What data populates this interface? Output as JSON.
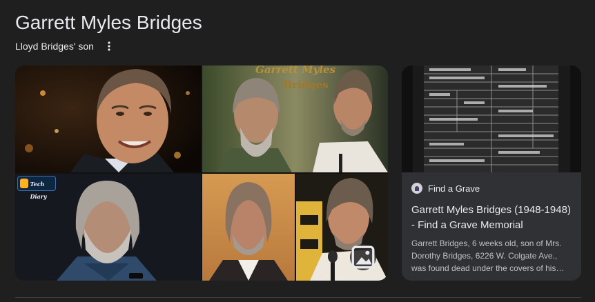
{
  "entity": {
    "title": "Garrett Myles Bridges",
    "subtitle": "Lloyd Bridges' son"
  },
  "images": {
    "tiles": [
      {
        "alt": "Man smiling at night event"
      },
      {
        "alt": "Garrett Myles Bridges side by side",
        "watermark_line1": "Garrett Myles",
        "watermark_line2": "Bridges"
      },
      {
        "alt": "Man with long grey hair and beard",
        "badge_line1": "The Tech",
        "badge_line2": "Diary"
      },
      {
        "alt": "Portrait on orange background"
      },
      {
        "alt": "Man speaking at a microphone"
      }
    ],
    "button_icon": "image-icon"
  },
  "source_card": {
    "source_name": "Find a Grave",
    "title": "Garrett Myles Bridges (1948-1948) - Find a Grave Memorial",
    "snippet": "Garrett Bridges, 6 weeks old, son of Mrs. Dorothy Bridges, 6226 W. Colgate Ave., was found dead under the covers of his…",
    "favicon_icon": "find-a-grave-icon"
  },
  "colors": {
    "background": "#1f1f1f",
    "card_background": "#303134",
    "primary_text": "#e8eaed",
    "secondary_text": "#bdc1c6"
  }
}
